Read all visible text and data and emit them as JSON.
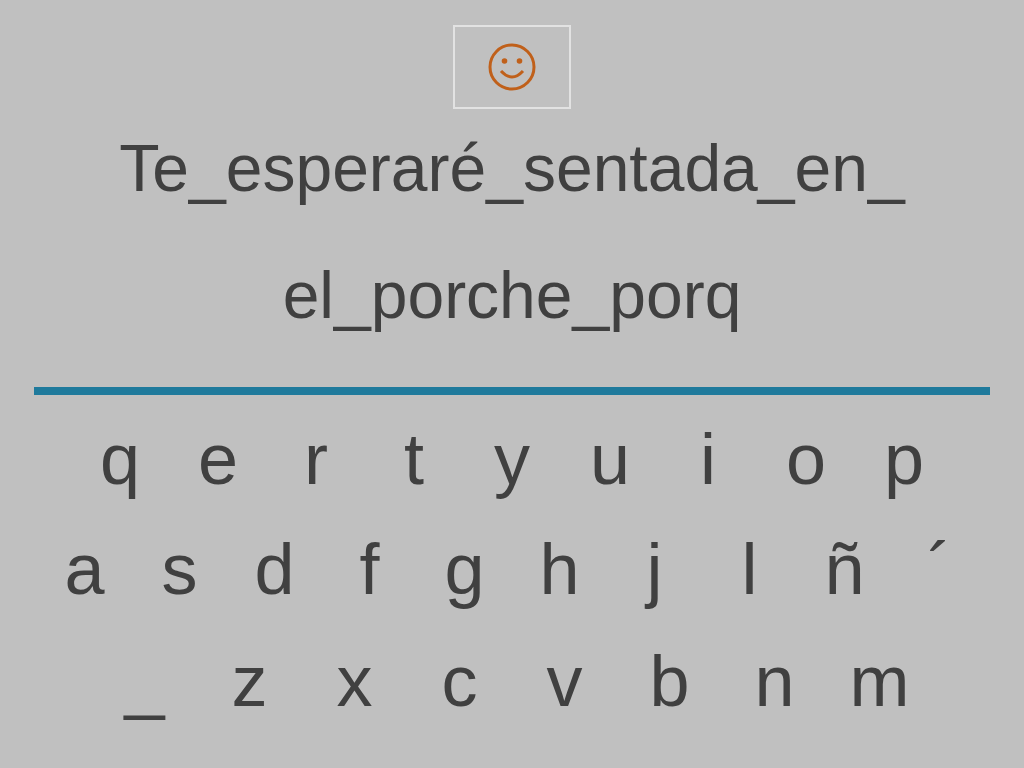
{
  "phrase_lines": [
    "Te_esperaré_sentada_en_",
    "el_porche_porq"
  ],
  "keyboard_rows": [
    [
      "q",
      "e",
      "r",
      "t",
      "y",
      "u",
      "i",
      "o",
      "p"
    ],
    [
      "a",
      "s",
      "d",
      "f",
      "g",
      "h",
      "j",
      "l",
      "ñ",
      "´"
    ],
    [
      "_",
      "z",
      "x",
      "c",
      "v",
      "b",
      "n",
      "m"
    ]
  ]
}
